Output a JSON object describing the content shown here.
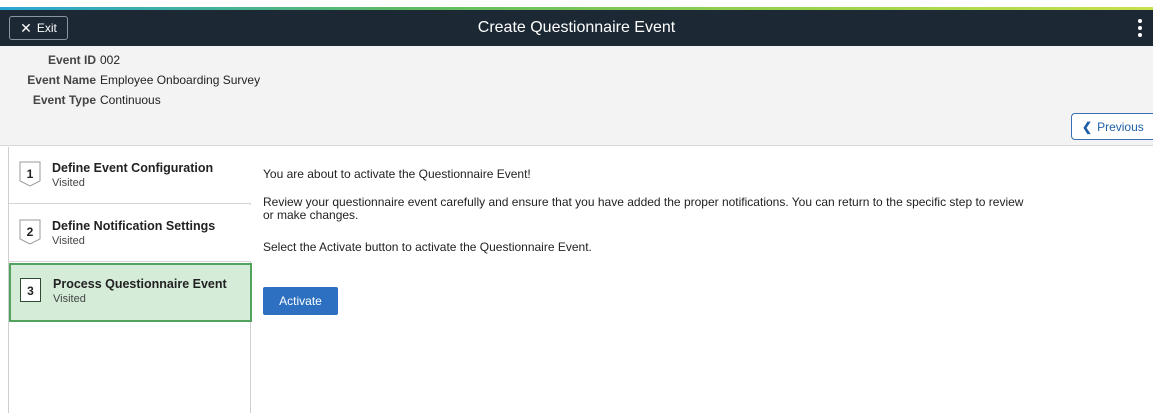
{
  "banner": {
    "exit_label": "Exit",
    "title": "Create Questionnaire Event"
  },
  "event": {
    "id_label": "Event ID",
    "id_value": "002",
    "name_label": "Event Name",
    "name_value": "Employee Onboarding Survey",
    "type_label": "Event Type",
    "type_value": "Continuous"
  },
  "nav": {
    "previous_label": "Previous"
  },
  "steps": [
    {
      "number": "1",
      "title": "Define Event Configuration",
      "status": "Visited",
      "active": false
    },
    {
      "number": "2",
      "title": "Define Notification Settings",
      "status": "Visited",
      "active": false
    },
    {
      "number": "3",
      "title": "Process Questionnaire Event",
      "status": "Visited",
      "active": true
    }
  ],
  "main": {
    "intro": "You are about to activate the Questionnaire Event!",
    "review": "Review your questionnaire event carefully and ensure that you have added the proper notifications. You can return to the specific step to review or make changes.",
    "instruction": "Select the Activate button to activate the Questionnaire Event.",
    "activate_label": "Activate"
  },
  "colors": {
    "banner_bg": "#1c2833",
    "active_step_bg": "#d4ecd8",
    "active_step_border": "#51a25d",
    "primary_button": "#2d6fc0",
    "link_blue": "#1f5fa8"
  }
}
